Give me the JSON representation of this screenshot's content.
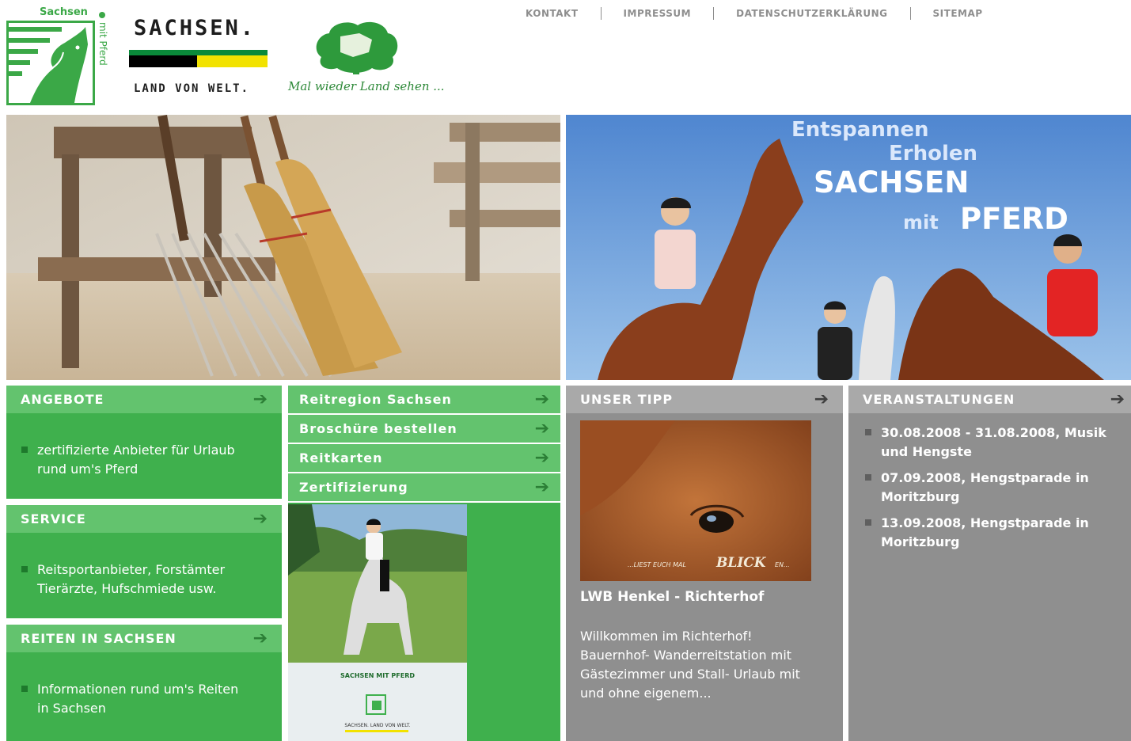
{
  "header": {
    "nav": [
      "KONTAKT",
      "IMPRESSUM",
      "DATENSCHUTZERKLÄRUNG",
      "SITEMAP"
    ],
    "logo_horse": {
      "top_label": "Sachsen",
      "side_label": "mit Pferd"
    },
    "brand": {
      "name": "SACHSEN.",
      "sub": "LAND VON WELT.",
      "flag_colors": [
        "#000000",
        "#0a8a3a",
        "#f2e200"
      ]
    },
    "slogan": "Mal wieder Land sehen ..."
  },
  "hero": {
    "line1": "Entspannen",
    "line2": "Erholen",
    "line3": "SACHSEN",
    "line4_small": "mit",
    "line4_big": "PFERD"
  },
  "left_panels": [
    {
      "title": "ANGEBOTE",
      "text": [
        "zertifizierte Anbieter für Urlaub",
        "rund um's Pferd"
      ]
    },
    {
      "title": "SERVICE",
      "text": [
        "Reitsportanbieter, Forstämter",
        "Tierärzte, Hufschmiede usw."
      ]
    },
    {
      "title": "REITEN IN SACHSEN",
      "text": [
        "Informationen rund um's Reiten",
        "in Sachsen"
      ]
    }
  ],
  "menu": [
    "Reitregion Sachsen",
    "Broschüre bestellen",
    "Reitkarten",
    "Zertifizierung"
  ],
  "brochure": {
    "title": "SACHSEN MIT PFERD",
    "footer": "SACHSEN. LAND VON WELT."
  },
  "tipp": {
    "title": "UNSER TIPP",
    "photo_caption_a": "...LIEST EUCH MAL",
    "photo_caption_b": "BLICK",
    "photo_caption_c": "EN...",
    "name": "LWB Henkel - Richterhof",
    "desc": [
      "Willkommen im Richterhof!",
      "Bauernhof- Wanderreitstation mit",
      "Gästezimmer und Stall- Urlaub mit",
      "und ohne eigenem..."
    ]
  },
  "events": {
    "title": "VERANSTALTUNGEN",
    "items": [
      [
        "30.08.2008 - 31.08.2008, Musik",
        "und Hengste"
      ],
      [
        "07.09.2008, Hengstparade in",
        "Moritzburg"
      ],
      [
        "13.09.2008, Hengstparade in",
        "Moritzburg"
      ]
    ]
  },
  "colors": {
    "green": "#3fb04d",
    "green_header": "#63c36e",
    "gray": "#8f8f8f",
    "gray_header": "#a9a9a9",
    "arrow_green": "#2c7f36"
  }
}
